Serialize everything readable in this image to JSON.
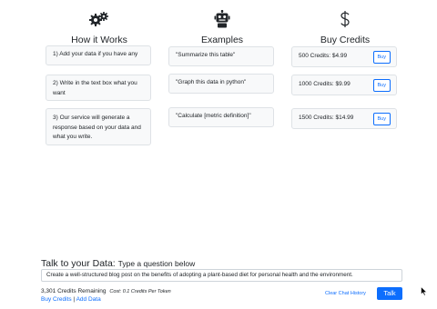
{
  "how_it_works": {
    "icon": "gears-icon",
    "title": "How it Works",
    "steps": [
      "1) Add your data if you have any",
      "2) Write in the text box what you want",
      "3) Our service will generate a response based on your data and what you write."
    ]
  },
  "examples": {
    "icon": "robot-icon",
    "title": "Examples",
    "items": [
      "\"Summarize this table\"",
      "\"Graph this data in python\"",
      "\"Calculate [metric definition]\""
    ]
  },
  "buy_credits": {
    "icon": "dollar-icon",
    "title": "Buy Credits",
    "packages": [
      {
        "label": "500 Credits: $4.99",
        "button": "Buy"
      },
      {
        "label": "1000 Credits: $9.99",
        "button": "Buy"
      },
      {
        "label": "1500 Credits: $14.99",
        "button": "Buy"
      }
    ]
  },
  "talk": {
    "heading": "Talk to your Data:",
    "subheading": "Type a question below",
    "input_value": "Create a well-structured blog post on the benefits of adopting a plant-based diet for personal health and the environment.",
    "credits_remaining": "3,301 Credits Remaining",
    "cost_note": "Cost: 0.1 Credits Per Token",
    "buy_credits_link": "Buy Credits",
    "separator": "|",
    "add_data_link": "Add Data",
    "clear_history": "Clear Chat History",
    "talk_button": "Talk"
  },
  "colors": {
    "accent": "#0d6efd",
    "card_bg": "#f8f9fa",
    "card_border": "#dee2e6"
  }
}
